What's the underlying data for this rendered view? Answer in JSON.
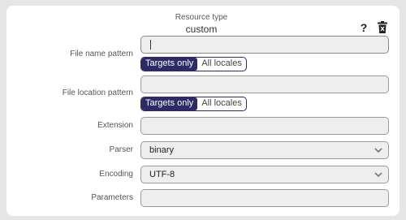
{
  "header": {
    "resource_type_label": "Resource type",
    "resource_type_value": "custom",
    "help_glyph": "?"
  },
  "icons": {
    "help": "question-icon",
    "delete": "trash-icon",
    "dropdown": "chevron-down-icon"
  },
  "colors": {
    "accent": "#2c2b66",
    "field_bg": "#eeeeee",
    "page_bg": "#e6e6e6"
  },
  "fields": {
    "file_name_pattern": {
      "label": "File name pattern",
      "value": ""
    },
    "file_location_pattern": {
      "label": "File location pattern",
      "value": ""
    },
    "extension": {
      "label": "Extension",
      "value": ""
    },
    "parser": {
      "label": "Parser",
      "value": "binary"
    },
    "encoding": {
      "label": "Encoding",
      "value": "UTF-8"
    },
    "parameters": {
      "label": "Parameters",
      "value": ""
    }
  },
  "toggle": {
    "targets_only": "Targets only",
    "all_locales": "All locales"
  }
}
